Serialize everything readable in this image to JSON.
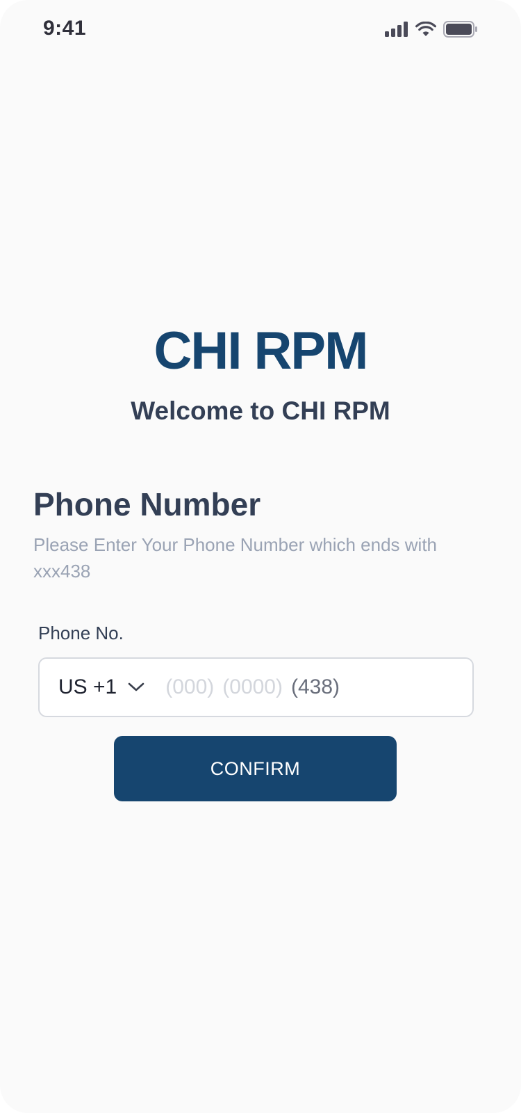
{
  "status_bar": {
    "time": "9:41",
    "icons": [
      "signal-icon",
      "wifi-icon",
      "battery-icon"
    ]
  },
  "brand": {
    "logo_text": "CHI RPM",
    "welcome": "Welcome to CHI RPM",
    "color": "#16456f"
  },
  "phone_section": {
    "title": "Phone Number",
    "description": "Please Enter Your Phone Number which ends with xxx438",
    "field_label": "Phone No.",
    "country_code": "US +1",
    "placeholder_area": "(000)",
    "placeholder_middle": "(0000)",
    "suffix": "(438)"
  },
  "actions": {
    "confirm_label": "CONFIRM"
  }
}
